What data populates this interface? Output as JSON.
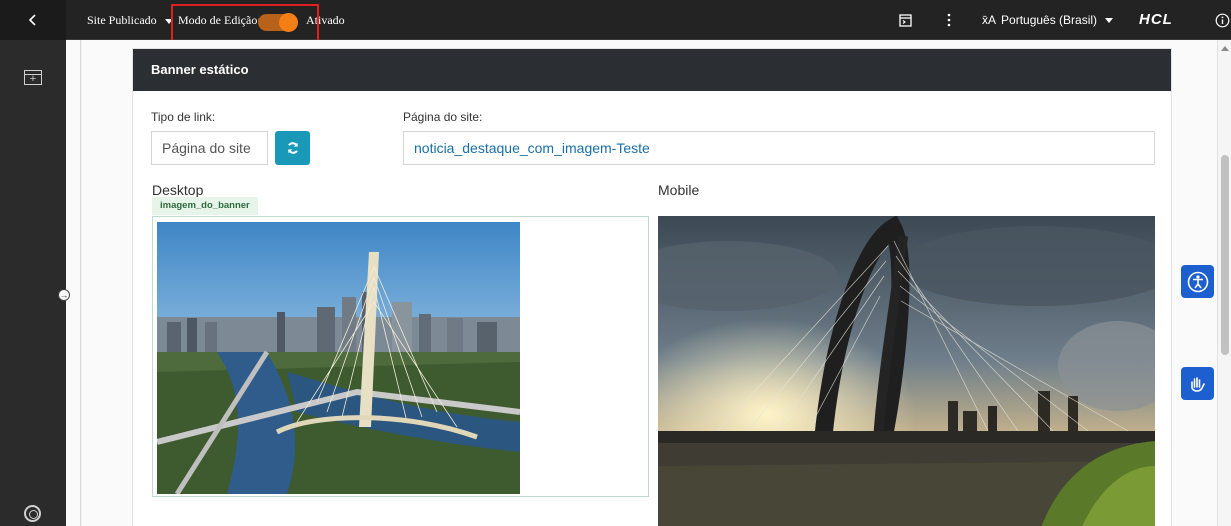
{
  "topbar": {
    "site_label": "Site Publicado",
    "edit_mode_label": "Modo de Edição:",
    "edit_mode_state": "Ativado",
    "edit_mode_on": true,
    "language": "Português (Brasil)",
    "brand": "HCL"
  },
  "panel": {
    "title": "Banner estático",
    "link_type_label": "Tipo de link:",
    "link_type_value": "Página do site",
    "site_page_label": "Página do site:",
    "site_page_value": "noticia_destaque_com_imagem-Teste",
    "desktop_label": "Desktop",
    "mobile_label": "Mobile",
    "image_tag": "imagem_do_banner"
  },
  "colors": {
    "topbar_bg": "#232323",
    "panel_header_bg": "#2b2e33",
    "toggle_on": "#f57f17",
    "refresh_button": "#1a98b8",
    "accessibility_blue": "#1d5fcf"
  },
  "icons": {
    "back": "chevron-left-icon",
    "site_caret": "caret-down-icon",
    "preview": "preview-panel-icon",
    "more": "more-vertical-icon",
    "translate": "translate-icon",
    "info": "info-icon",
    "add_content": "add-content-icon",
    "help": "lifebuoy-icon",
    "expand_panel": "arrow-right-circle-icon",
    "refresh": "refresh-icon",
    "accessibility": "accessibility-icon",
    "sign_language": "sign-language-icon"
  }
}
